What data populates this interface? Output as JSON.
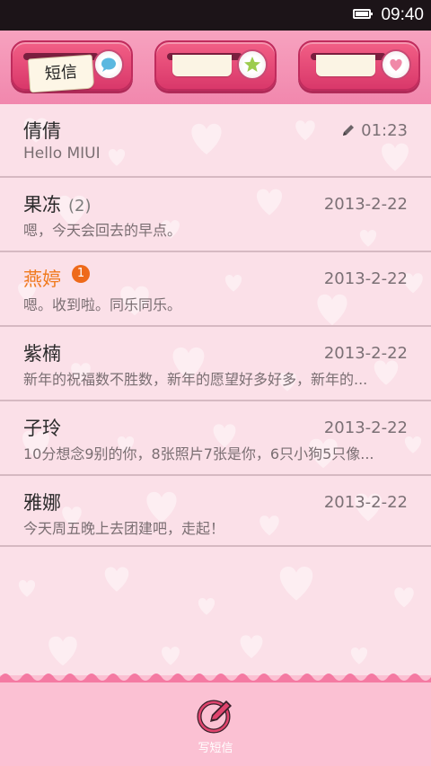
{
  "status_bar": {
    "time": "09:40"
  },
  "tabs": [
    {
      "label": "短信",
      "icon": "speech-bubble-icon",
      "active": true
    },
    {
      "label": "",
      "icon": "star-icon",
      "active": false
    },
    {
      "label": "",
      "icon": "heart-icon",
      "active": false
    }
  ],
  "conversations": [
    {
      "name": "倩倩",
      "count": "",
      "unread": "",
      "date": "01:23",
      "draft": true,
      "preview": "Hello MIUI"
    },
    {
      "name": "果冻",
      "count": "(2)",
      "unread": "",
      "date": "2013-2-22",
      "draft": false,
      "preview": "嗯，今天会回去的早点。"
    },
    {
      "name": "燕婷",
      "count": "",
      "unread": "1",
      "date": "2013-2-22",
      "draft": false,
      "preview": "嗯。收到啦。同乐同乐。"
    },
    {
      "name": "紫楠",
      "count": "",
      "unread": "",
      "date": "2013-2-22",
      "draft": false,
      "preview": "新年的祝福数不胜数，新年的愿望好多好多，新年的..."
    },
    {
      "name": "子玲",
      "count": "",
      "unread": "",
      "date": "2013-2-22",
      "draft": false,
      "preview": "10分想念9别的你，8张照片7张是你，6只小狗5只像..."
    },
    {
      "name": "雅娜",
      "count": "",
      "unread": "",
      "date": "2013-2-22",
      "draft": false,
      "preview": "今天周五晚上去团建吧，走起！"
    }
  ],
  "bottom_bar": {
    "compose_label": "写短信",
    "compose_icon": "pencil-circle-icon"
  },
  "colors": {
    "accent_pink": "#f25f86",
    "unread_orange": "#f07a1e",
    "background": "#fbe0e8"
  }
}
